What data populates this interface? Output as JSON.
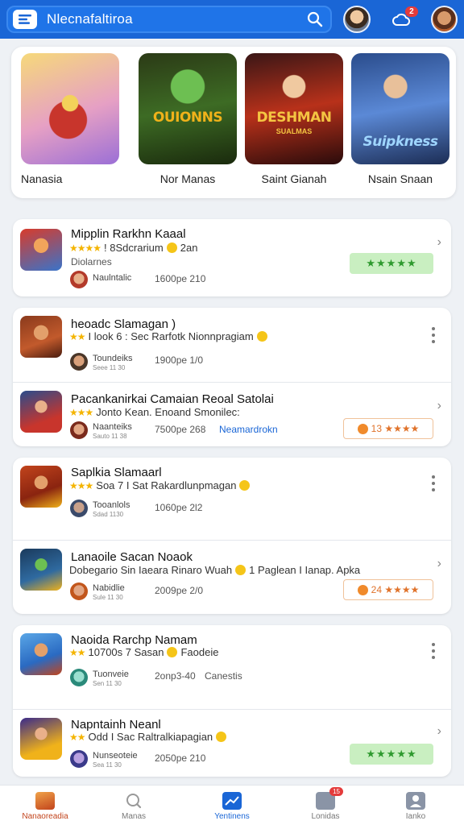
{
  "header": {
    "title": "Nlecnafaltiroa",
    "notification_count": "2"
  },
  "featured": [
    {
      "label": "Nanasia",
      "art_text": "",
      "art_sub": ""
    },
    {
      "label": "Nor Manas",
      "art_text": "OUIONNS",
      "art_sub": ""
    },
    {
      "label": "Saint Gianah",
      "art_text": "DESHMAN",
      "art_sub": "SUALMAS"
    },
    {
      "label": "Nsain Snaan",
      "art_text": "Suipkness",
      "art_sub": ""
    }
  ],
  "items": [
    {
      "title": "Mipplin Rarkhn Kaaal",
      "line2_rating": "★★★★",
      "line2": "! 8Sdcrarium",
      "line2_tail": "2an",
      "line3": "Diolarnes",
      "meta_name": "Naulntalic",
      "meta_sub": "",
      "date": "1600pe 210",
      "badge": "★★★★★",
      "badge_type": "green"
    },
    {
      "title": "heoadc Slamagan  )",
      "line2_rating": "★★",
      "line2": "I look 6 : Sec Rarfotk Nionnpragiam",
      "line2_tail": "",
      "line3": "",
      "meta_name": "Toundeiks",
      "meta_sub": "Seee 11 30",
      "date": "1900pe 1/0",
      "badge": "",
      "badge_type": "kebab"
    },
    {
      "title": "Pacankanirkai Camaian Reoal Satolai",
      "line2_rating": "★★★",
      "line2": "Jonto  Kean. Enoand Smonilec:",
      "line2_tail": "",
      "line3": "",
      "meta_name": "Naanteiks",
      "meta_sub": "Sauto 11 38",
      "date": "7500pe 268",
      "link": "Neamardrokn",
      "badge": "13 ★★★★",
      "badge_type": "orange"
    },
    {
      "title": "Saplkia Slamaarl",
      "line2_rating": "★★★",
      "line2": "Soa 7 I Sat Rakardlunpmagan",
      "line2_tail": "",
      "line3": "",
      "meta_name": "Tooanlols",
      "meta_sub": "Sdad 1130",
      "date": "1060pe 2l2",
      "badge": "",
      "badge_type": "kebab"
    },
    {
      "title": "Lanaoile Sacan Noaok",
      "line2_rating": "",
      "line2": "Dobegario Sin Iaeara Rinaro Wuah",
      "line2_tail": "1 Paglean I Ianap. Apka",
      "line3": "",
      "meta_name": "Nabidlie",
      "meta_sub": "Sule 11 30",
      "date": "2009pe 2/0",
      "badge": "24 ★★★★",
      "badge_type": "orange"
    },
    {
      "title": "Naoida Rarchp Namam",
      "line2_rating": "★★",
      "line2": "10700s 7 Sasan",
      "line2_tail": "Faodeie",
      "line3": "",
      "meta_name": "Tuonveie",
      "meta_sub": "Sen 11 30",
      "date": "2onp3-40",
      "extra": "Canestis",
      "badge": "",
      "badge_type": "kebab"
    },
    {
      "title": "Napntainh Neanl",
      "line2_rating": "★★",
      "line2": "Odd I Sac Raltralkiapagian",
      "line2_tail": "",
      "line3": "",
      "meta_name": "Nunseoteie",
      "meta_sub": "Sea 11 30",
      "date": "2050pe 210",
      "badge": "★★★★★",
      "badge_type": "green"
    }
  ],
  "nav": [
    {
      "label": "Nanaoreadia",
      "active": false
    },
    {
      "label": "Manas",
      "active": false
    },
    {
      "label": "Yentinens",
      "active": true
    },
    {
      "label": "Lonidas",
      "active": false,
      "badge": "15"
    },
    {
      "label": "Ianko",
      "active": false
    }
  ],
  "colors": {
    "primary": "#1a66d6",
    "rating_star": "#f4b400",
    "badge_green": "#c9efc1",
    "badge_orange": "#e0732b"
  }
}
